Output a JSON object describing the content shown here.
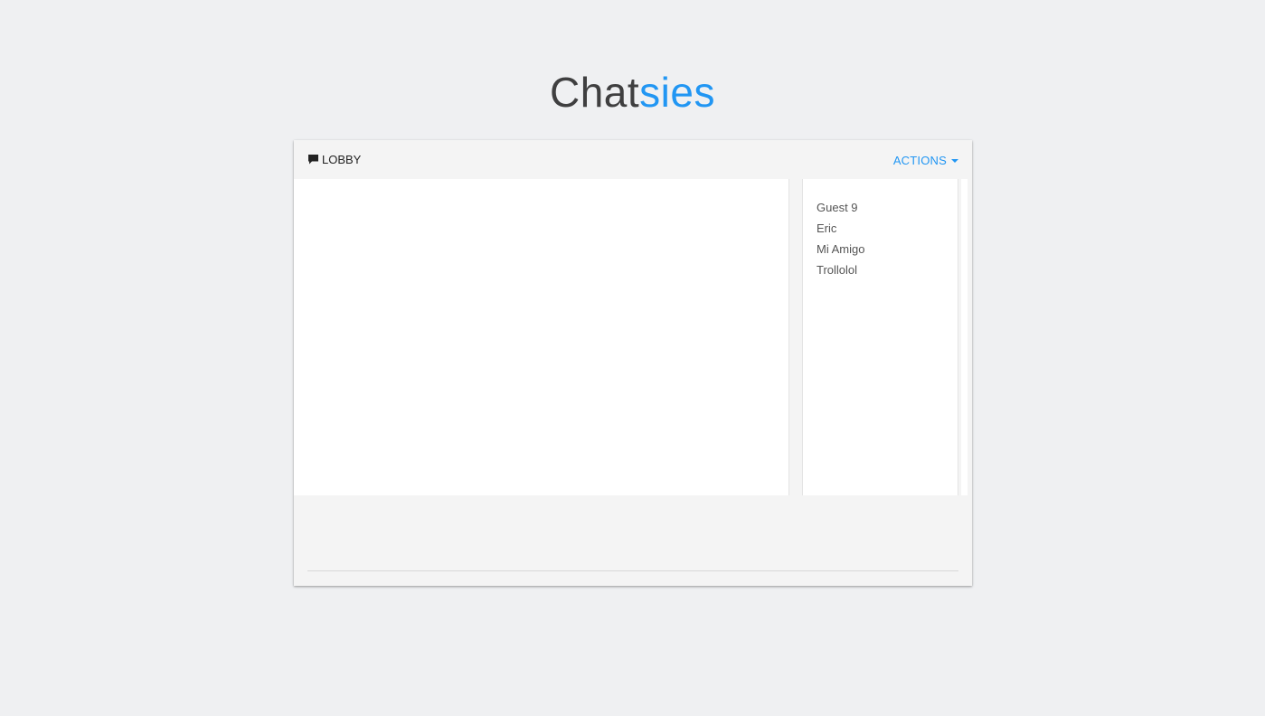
{
  "app": {
    "logo_part1": "Chat",
    "logo_part2": "sies",
    "accent_color": "#2196f3"
  },
  "room": {
    "icon": "chat-bubble-icon",
    "title": "LOBBY"
  },
  "actions": {
    "label": "ACTIONS",
    "icon": "caret-down-icon"
  },
  "users": [
    {
      "name": "Guest 9"
    },
    {
      "name": "Eric"
    },
    {
      "name": "Mi Amigo"
    },
    {
      "name": "Trollolol"
    }
  ],
  "composer": {
    "value": "",
    "placeholder": ""
  }
}
